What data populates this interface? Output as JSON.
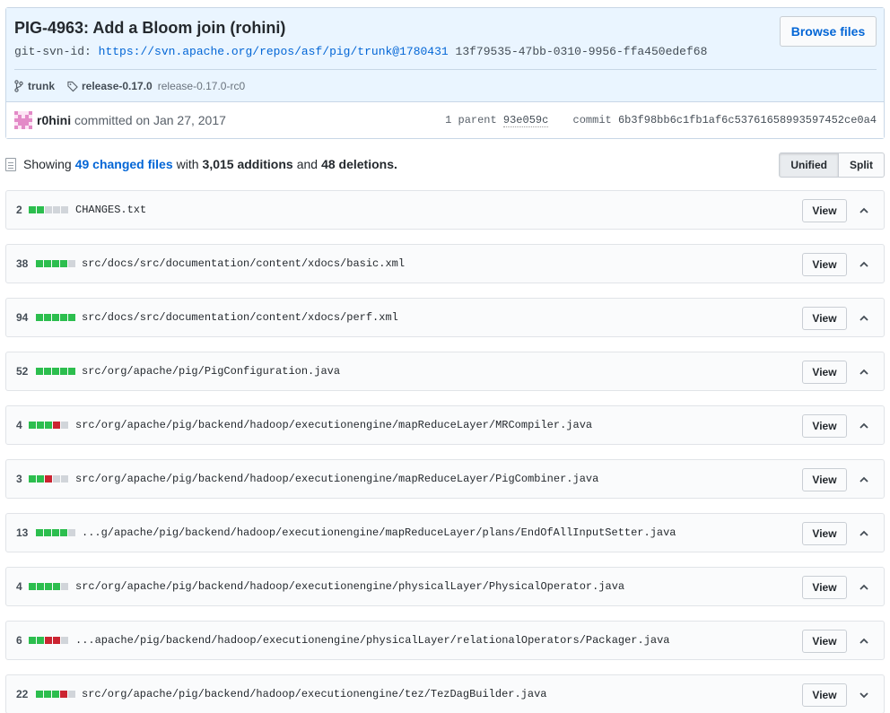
{
  "commit": {
    "title": "PIG-4963: Add a Bloom join (rohini)",
    "browse_label": "Browse files",
    "svn_label": "git-svn-id:",
    "svn_url": "https://svn.apache.org/repos/asf/pig/trunk@1780431",
    "svn_uuid": "13f79535-47bb-0310-9956-ffa450edef68",
    "branch": "trunk",
    "tag": "release-0.17.0",
    "tag_rc": "release-0.17.0-rc0",
    "author": "r0hini",
    "committed_text": "committed on Jan 27, 2017",
    "parent_label": "1 parent",
    "parent_sha": "93e059c",
    "commit_label": "commit",
    "commit_sha": "6b3f98bb6c1fb1af6c53761658993597452ce0a4"
  },
  "toc": {
    "showing": "Showing",
    "changed_files": "49 changed files",
    "with": "with",
    "additions": "3,015 additions",
    "and": "and",
    "deletions": "48 deletions.",
    "unified": "Unified",
    "split": "Split"
  },
  "colors": {
    "add": "#2cbe4e",
    "del": "#cb2431",
    "neutral": "#d1d5da"
  },
  "files": [
    {
      "count": "2",
      "bars": [
        "a",
        "a",
        "n",
        "n",
        "n"
      ],
      "path": "CHANGES.txt",
      "view": "View",
      "chevron": "up"
    },
    {
      "count": "38",
      "bars": [
        "a",
        "a",
        "a",
        "a",
        "n"
      ],
      "path": "src/docs/src/documentation/content/xdocs/basic.xml",
      "view": "View",
      "chevron": "up"
    },
    {
      "count": "94",
      "bars": [
        "a",
        "a",
        "a",
        "a",
        "a"
      ],
      "path": "src/docs/src/documentation/content/xdocs/perf.xml",
      "view": "View",
      "chevron": "up"
    },
    {
      "count": "52",
      "bars": [
        "a",
        "a",
        "a",
        "a",
        "a"
      ],
      "path": "src/org/apache/pig/PigConfiguration.java",
      "view": "View",
      "chevron": "up"
    },
    {
      "count": "4",
      "bars": [
        "a",
        "a",
        "a",
        "d",
        "n"
      ],
      "path": "src/org/apache/pig/backend/hadoop/executionengine/mapReduceLayer/MRCompiler.java",
      "view": "View",
      "chevron": "up"
    },
    {
      "count": "3",
      "bars": [
        "a",
        "a",
        "d",
        "n",
        "n"
      ],
      "path": "src/org/apache/pig/backend/hadoop/executionengine/mapReduceLayer/PigCombiner.java",
      "view": "View",
      "chevron": "up"
    },
    {
      "count": "13",
      "bars": [
        "a",
        "a",
        "a",
        "a",
        "n"
      ],
      "path": "...g/apache/pig/backend/hadoop/executionengine/mapReduceLayer/plans/EndOfAllInputSetter.java",
      "view": "View",
      "chevron": "up"
    },
    {
      "count": "4",
      "bars": [
        "a",
        "a",
        "a",
        "a",
        "n"
      ],
      "path": "src/org/apache/pig/backend/hadoop/executionengine/physicalLayer/PhysicalOperator.java",
      "view": "View",
      "chevron": "up"
    },
    {
      "count": "6",
      "bars": [
        "a",
        "a",
        "d",
        "d",
        "n"
      ],
      "path": "...apache/pig/backend/hadoop/executionengine/physicalLayer/relationalOperators/Packager.java",
      "view": "View",
      "chevron": "up"
    },
    {
      "count": "22",
      "bars": [
        "a",
        "a",
        "a",
        "d",
        "n"
      ],
      "path": "src/org/apache/pig/backend/hadoop/executionengine/tez/TezDagBuilder.java",
      "view": "View",
      "chevron": "down"
    }
  ]
}
